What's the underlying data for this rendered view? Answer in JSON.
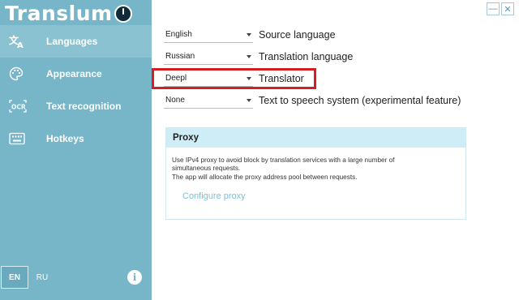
{
  "app": {
    "title": "Translum"
  },
  "window": {
    "minimize": "—",
    "close": "✕"
  },
  "sidebar": {
    "items": [
      {
        "label": "Languages",
        "icon": "translate-icon"
      },
      {
        "label": "Appearance",
        "icon": "palette-icon"
      },
      {
        "label": "Text recognition",
        "icon": "ocr-icon"
      },
      {
        "label": "Hotkeys",
        "icon": "keyboard-icon"
      }
    ],
    "languages": [
      "EN",
      "RU"
    ],
    "info": "i"
  },
  "settings": [
    {
      "value": "English",
      "label": "Source language"
    },
    {
      "value": "Russian",
      "label": "Translation language"
    },
    {
      "value": "Deepl",
      "label": "Translator"
    },
    {
      "value": "None",
      "label": "Text to speech system (experimental feature)"
    }
  ],
  "proxy": {
    "title": "Proxy",
    "description": [
      "Use IPv4 proxy to avoid block by translation services with a large number of",
      "simultaneous requests.",
      "The app will allocate the proxy address pool between requests."
    ],
    "link": "Configure proxy"
  },
  "colors": {
    "sidebar": "#77b5c8",
    "active": "#8bc2d2",
    "highlight": "#d11f26",
    "proxy_header": "#cfedf6",
    "link": "#7cc0d6"
  }
}
